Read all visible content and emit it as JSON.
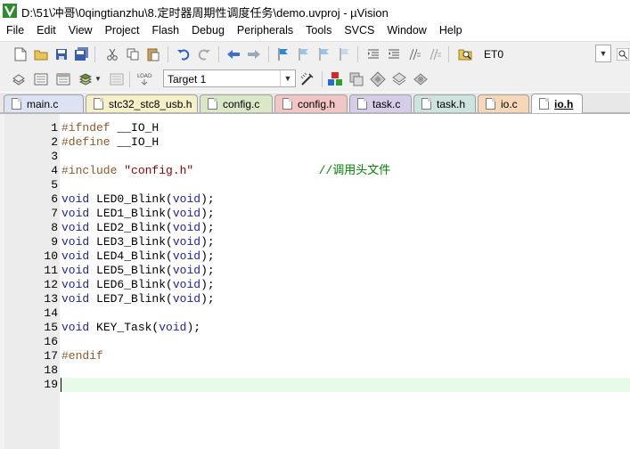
{
  "window": {
    "title": "D:\\51\\冲哥\\0qingtianzhu\\8.定时器周期性调度任务\\demo.uvproj - µVision"
  },
  "menu": [
    "File",
    "Edit",
    "View",
    "Project",
    "Flash",
    "Debug",
    "Peripherals",
    "Tools",
    "SVCS",
    "Window",
    "Help"
  ],
  "toolbar1": {
    "find_value": "ET0"
  },
  "toolbar2": {
    "target_value": "Target 1"
  },
  "tabs": [
    {
      "label": "main.c",
      "color": "#dde3f3"
    },
    {
      "label": "stc32_stc8_usb.h",
      "color": "#f5f0c8"
    },
    {
      "label": "config.c",
      "color": "#dbe8c8"
    },
    {
      "label": "config.h",
      "color": "#f3c6c6"
    },
    {
      "label": "task.c",
      "color": "#d6cde8"
    },
    {
      "label": "task.h",
      "color": "#cde3dd"
    },
    {
      "label": "io.c",
      "color": "#f6d8b8"
    },
    {
      "label": "io.h",
      "color": "#ffffff"
    }
  ],
  "editor": {
    "lines": [
      {
        "n": "1",
        "t": [
          {
            "c": "pp",
            "s": "#ifndef "
          },
          {
            "c": "plain",
            "s": "__IO_H"
          }
        ]
      },
      {
        "n": "2",
        "t": [
          {
            "c": "pp",
            "s": "#define "
          },
          {
            "c": "plain",
            "s": "__IO_H"
          }
        ]
      },
      {
        "n": "3",
        "t": []
      },
      {
        "n": "4",
        "t": [
          {
            "c": "pp",
            "s": "#include "
          },
          {
            "c": "str",
            "s": "\"config.h\""
          },
          {
            "c": "plain",
            "s": "                  "
          },
          {
            "c": "cmt",
            "s": "//调用头文件"
          }
        ]
      },
      {
        "n": "5",
        "t": []
      },
      {
        "n": "6",
        "t": [
          {
            "c": "kw",
            "s": "void"
          },
          {
            "c": "plain",
            "s": " LED0_Blink("
          },
          {
            "c": "kw",
            "s": "void"
          },
          {
            "c": "plain",
            "s": ");"
          }
        ]
      },
      {
        "n": "7",
        "t": [
          {
            "c": "kw",
            "s": "void"
          },
          {
            "c": "plain",
            "s": " LED1_Blink("
          },
          {
            "c": "kw",
            "s": "void"
          },
          {
            "c": "plain",
            "s": ");"
          }
        ]
      },
      {
        "n": "8",
        "t": [
          {
            "c": "kw",
            "s": "void"
          },
          {
            "c": "plain",
            "s": " LED2_Blink("
          },
          {
            "c": "kw",
            "s": "void"
          },
          {
            "c": "plain",
            "s": ");"
          }
        ]
      },
      {
        "n": "9",
        "t": [
          {
            "c": "kw",
            "s": "void"
          },
          {
            "c": "plain",
            "s": " LED3_Blink("
          },
          {
            "c": "kw",
            "s": "void"
          },
          {
            "c": "plain",
            "s": ");"
          }
        ]
      },
      {
        "n": "10",
        "t": [
          {
            "c": "kw",
            "s": "void"
          },
          {
            "c": "plain",
            "s": " LED4_Blink("
          },
          {
            "c": "kw",
            "s": "void"
          },
          {
            "c": "plain",
            "s": ");"
          }
        ]
      },
      {
        "n": "11",
        "t": [
          {
            "c": "kw",
            "s": "void"
          },
          {
            "c": "plain",
            "s": " LED5_Blink("
          },
          {
            "c": "kw",
            "s": "void"
          },
          {
            "c": "plain",
            "s": ");"
          }
        ]
      },
      {
        "n": "12",
        "t": [
          {
            "c": "kw",
            "s": "void"
          },
          {
            "c": "plain",
            "s": " LED6_Blink("
          },
          {
            "c": "kw",
            "s": "void"
          },
          {
            "c": "plain",
            "s": ");"
          }
        ]
      },
      {
        "n": "13",
        "t": [
          {
            "c": "kw",
            "s": "void"
          },
          {
            "c": "plain",
            "s": " LED7_Blink("
          },
          {
            "c": "kw",
            "s": "void"
          },
          {
            "c": "plain",
            "s": ");"
          }
        ]
      },
      {
        "n": "14",
        "t": []
      },
      {
        "n": "15",
        "t": [
          {
            "c": "kw",
            "s": "void"
          },
          {
            "c": "plain",
            "s": " KEY_Task("
          },
          {
            "c": "kw",
            "s": "void"
          },
          {
            "c": "plain",
            "s": ");"
          }
        ]
      },
      {
        "n": "16",
        "t": []
      },
      {
        "n": "17",
        "t": [
          {
            "c": "pp",
            "s": "#endif"
          }
        ]
      },
      {
        "n": "18",
        "t": []
      },
      {
        "n": "19",
        "t": []
      }
    ],
    "current_line": "19",
    "highlight_color": "#e8fbe8"
  }
}
